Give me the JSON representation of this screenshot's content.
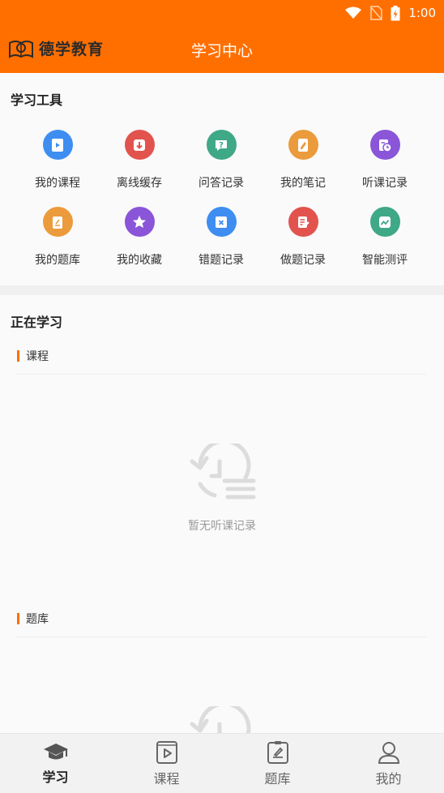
{
  "status": {
    "time": "1:00"
  },
  "header": {
    "logo_text": "德学教育",
    "title": "学习中心"
  },
  "tools": {
    "title": "学习工具",
    "items": [
      {
        "label": "我的课程",
        "color": "#3d8ef0",
        "icon": "play-card-icon"
      },
      {
        "label": "离线缓存",
        "color": "#e2534e",
        "icon": "download-icon"
      },
      {
        "label": "问答记录",
        "color": "#3fa886",
        "icon": "question-icon"
      },
      {
        "label": "我的笔记",
        "color": "#eb9b3c",
        "icon": "note-icon"
      },
      {
        "label": "听课记录",
        "color": "#8a55d8",
        "icon": "history-icon"
      },
      {
        "label": "我的题库",
        "color": "#eb9b3c",
        "icon": "question-bank-icon"
      },
      {
        "label": "我的收藏",
        "color": "#8a55d8",
        "icon": "star-icon"
      },
      {
        "label": "错题记录",
        "color": "#3d8ef0",
        "icon": "wrong-question-icon"
      },
      {
        "label": "做题记录",
        "color": "#e2534e",
        "icon": "edit-record-icon"
      },
      {
        "label": "智能测评",
        "color": "#3fa886",
        "icon": "assessment-icon"
      }
    ]
  },
  "learning": {
    "title": "正在学习",
    "course_header": "课程",
    "empty_text": "暂无听课记录",
    "bank_header": "题库"
  },
  "tabbar": {
    "items": [
      {
        "label": "学习",
        "icon": "graduation-cap-icon",
        "active": true
      },
      {
        "label": "课程",
        "icon": "video-icon",
        "active": false
      },
      {
        "label": "题库",
        "icon": "exam-icon",
        "active": false
      },
      {
        "label": "我的",
        "icon": "user-icon",
        "active": false
      }
    ]
  }
}
